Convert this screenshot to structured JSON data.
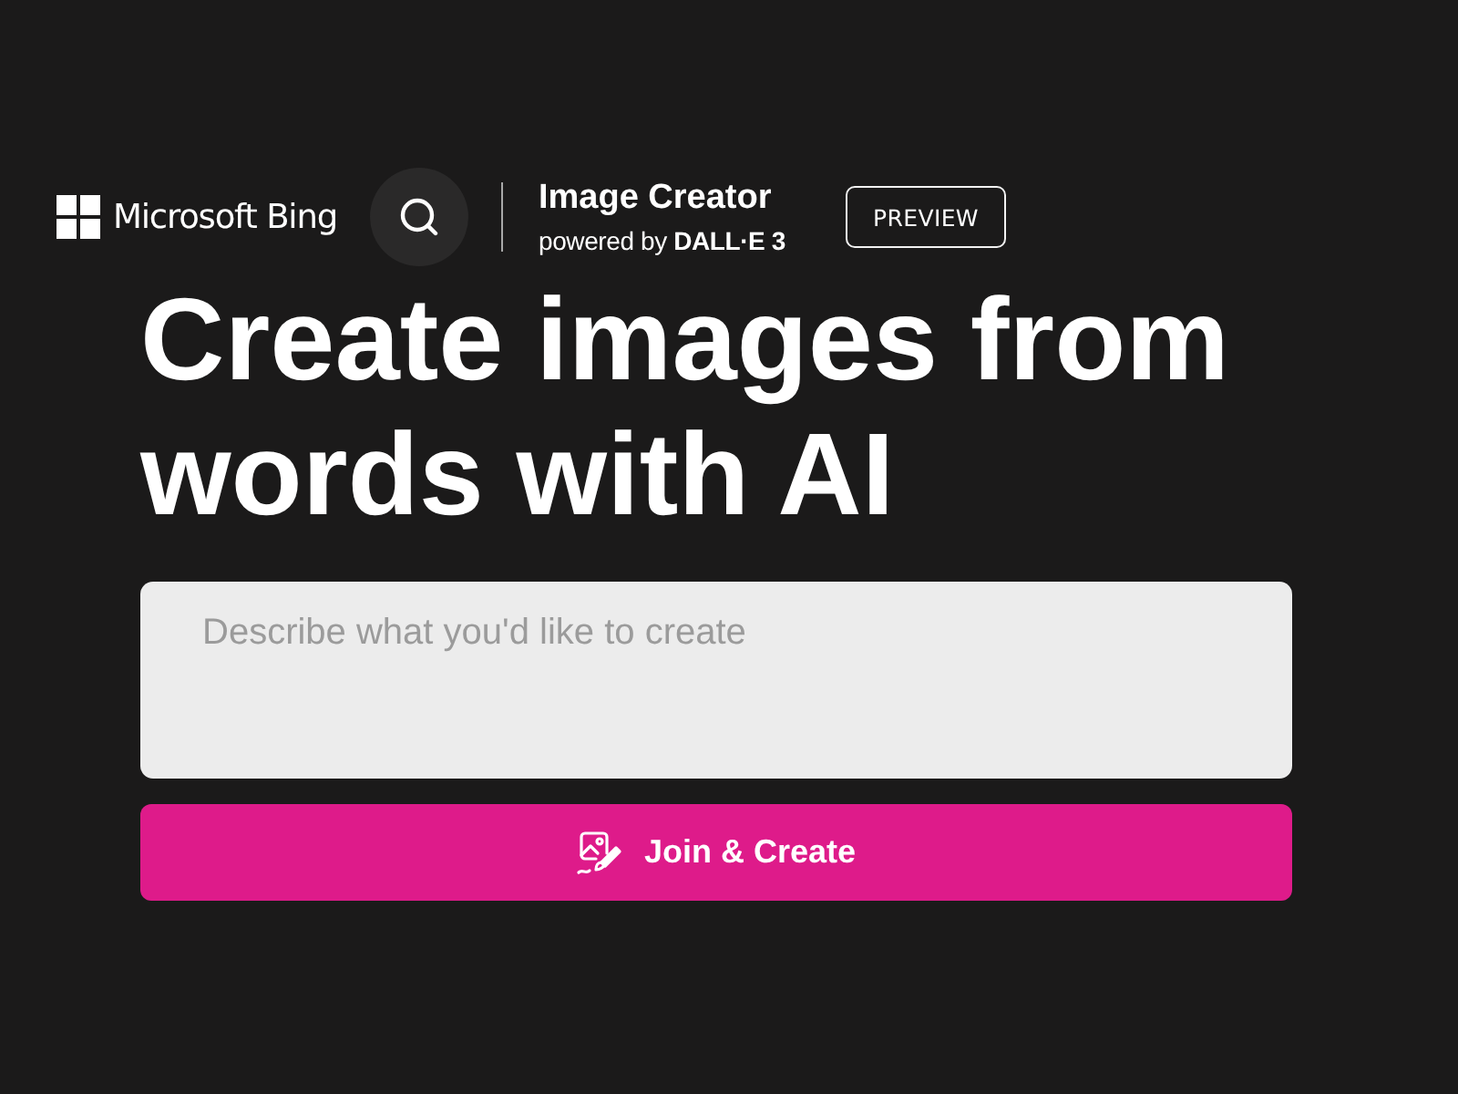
{
  "header": {
    "brand": "Microsoft Bing",
    "product": {
      "title": "Image Creator",
      "subtitle": "powered by **DALL·E 3**"
    },
    "badge": "PREVIEW"
  },
  "heading": "Create images from words with AI",
  "prompt": {
    "placeholder": "Describe what you'd like to create"
  },
  "submit_button": {
    "label": "Join & Create"
  }
}
